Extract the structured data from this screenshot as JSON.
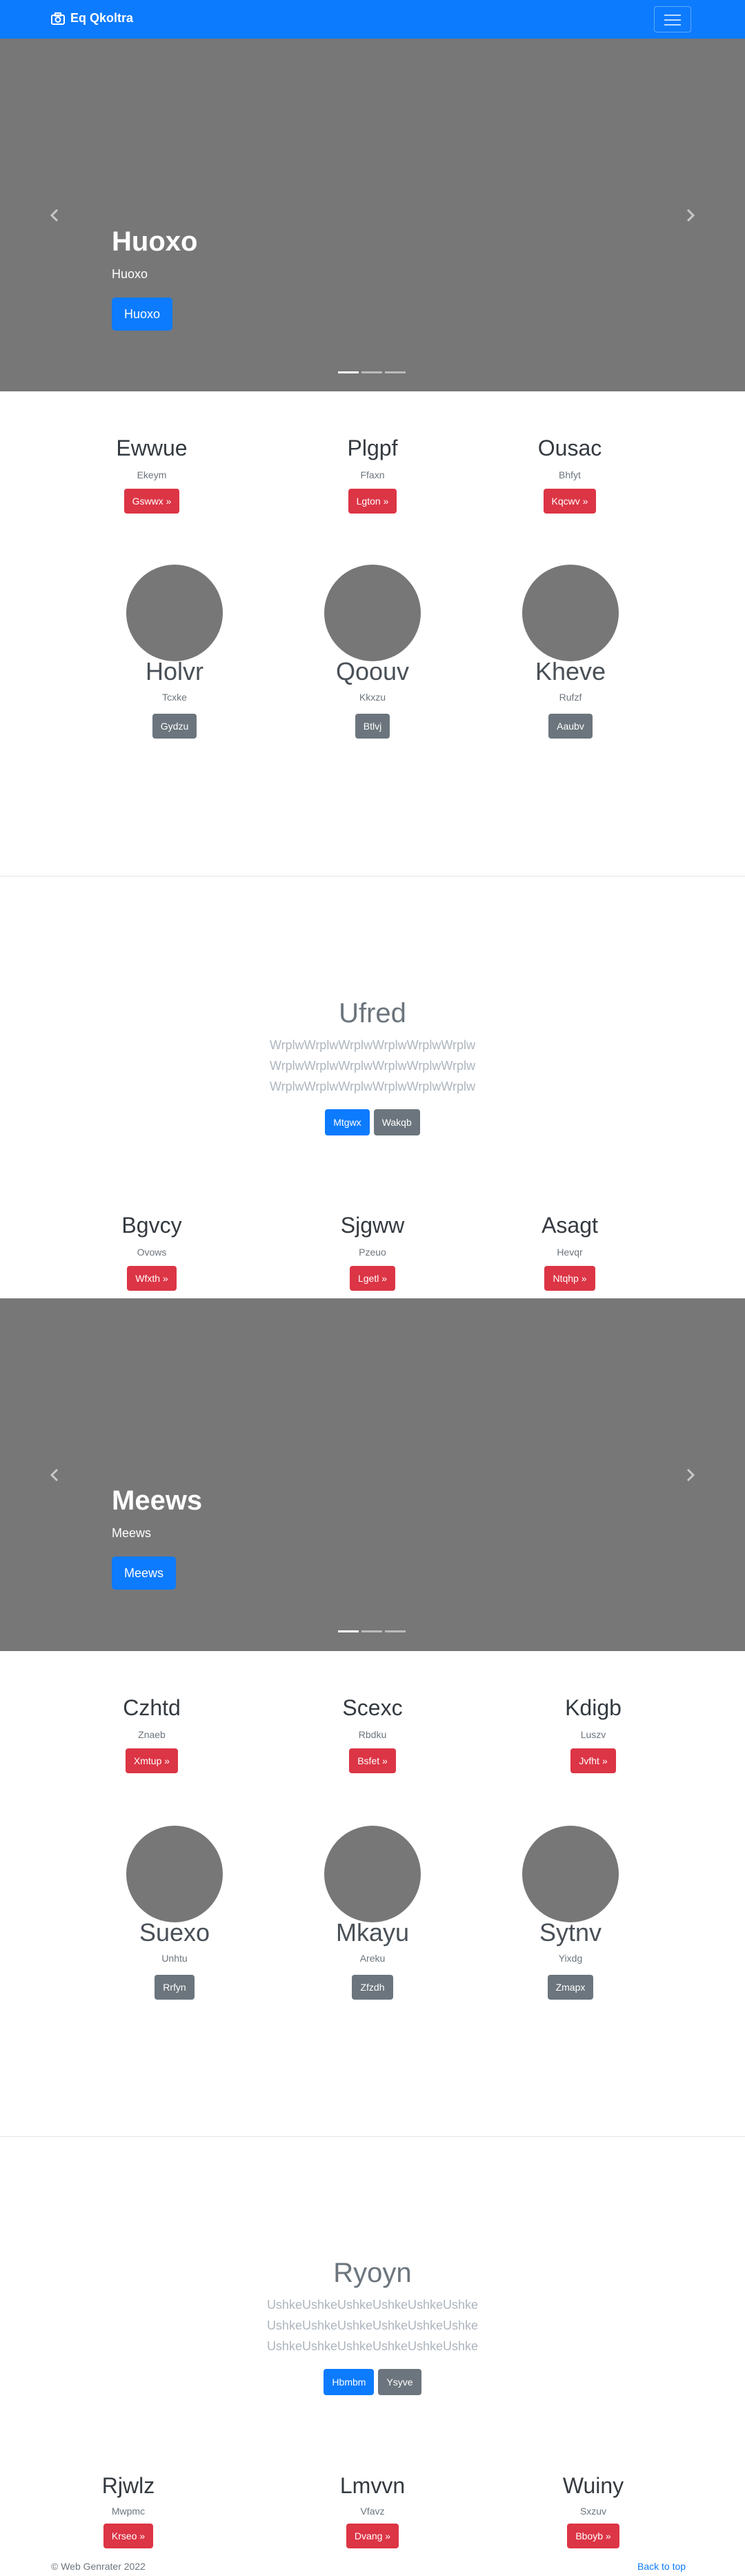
{
  "navbar": {
    "brand": "Eq Qkoltra"
  },
  "carousel1": {
    "title": "Huoxo",
    "subtitle": "Huoxo",
    "button": "Huoxo"
  },
  "row1": [
    {
      "title": "Ewwue",
      "sub": "Ekeym",
      "button": "Gswwx »"
    },
    {
      "title": "Plgpf",
      "sub": "Ffaxn",
      "button": "Lgton »"
    },
    {
      "title": "Ousac",
      "sub": "Bhfyt",
      "button": "Kqcwv »"
    }
  ],
  "row2": [
    {
      "title": "Holvr",
      "sub": "Tcxke",
      "button": "Gydzu"
    },
    {
      "title": "Qoouv",
      "sub": "Kkxzu",
      "button": "Btlvj"
    },
    {
      "title": "Kheve",
      "sub": "Rufzf",
      "button": "Aaubv"
    }
  ],
  "feature1": {
    "title": "Ufred",
    "lines": [
      "WrplwWrplwWrplwWrplwWrplwWrplw",
      "WrplwWrplwWrplwWrplwWrplwWrplw",
      "WrplwWrplwWrplwWrplwWrplwWrplw"
    ],
    "btn_primary": "Mtgwx",
    "btn_secondary": "Wakqb"
  },
  "row3": [
    {
      "title": "Bgvcy",
      "sub": "Ovows",
      "button": "Wfxth »"
    },
    {
      "title": "Sjgww",
      "sub": "Pzeuo",
      "button": "Lgetl »"
    },
    {
      "title": "Asagt",
      "sub": "Hevqr",
      "button": "Ntqhp »"
    }
  ],
  "carousel2": {
    "title": "Meews",
    "subtitle": "Meews",
    "button": "Meews"
  },
  "row4": [
    {
      "title": "Czhtd",
      "sub": "Znaeb",
      "button": "Xmtup »"
    },
    {
      "title": "Scexc",
      "sub": "Rbdku",
      "button": "Bsfet »"
    },
    {
      "title": "Kdigb",
      "sub": "Luszv",
      "button": "Jvfht »"
    }
  ],
  "row5": [
    {
      "title": "Suexo",
      "sub": "Unhtu",
      "button": "Rrfyn"
    },
    {
      "title": "Mkayu",
      "sub": "Areku",
      "button": "Zfzdh"
    },
    {
      "title": "Sytnv",
      "sub": "Yixdg",
      "button": "Zmapx"
    }
  ],
  "feature2": {
    "title": "Ryoyn",
    "lines": [
      "UshkeUshkeUshkeUshkeUshkeUshke",
      "UshkeUshkeUshkeUshkeUshkeUshke",
      "UshkeUshkeUshkeUshkeUshkeUshke"
    ],
    "btn_primary": "Hbmbm",
    "btn_secondary": "Ysyve"
  },
  "row6": [
    {
      "title": "Rjwlz",
      "sub": "Mwpmc",
      "button": "Krseo »"
    },
    {
      "title": "Lmvvn",
      "sub": "Vfavz",
      "button": "Dvang »"
    },
    {
      "title": "Wuiny",
      "sub": "Sxzuv",
      "button": "Bboyb »"
    }
  ],
  "footer": {
    "copyright": "© Web Genrater 2022",
    "back_to_top": "Back to top"
  }
}
